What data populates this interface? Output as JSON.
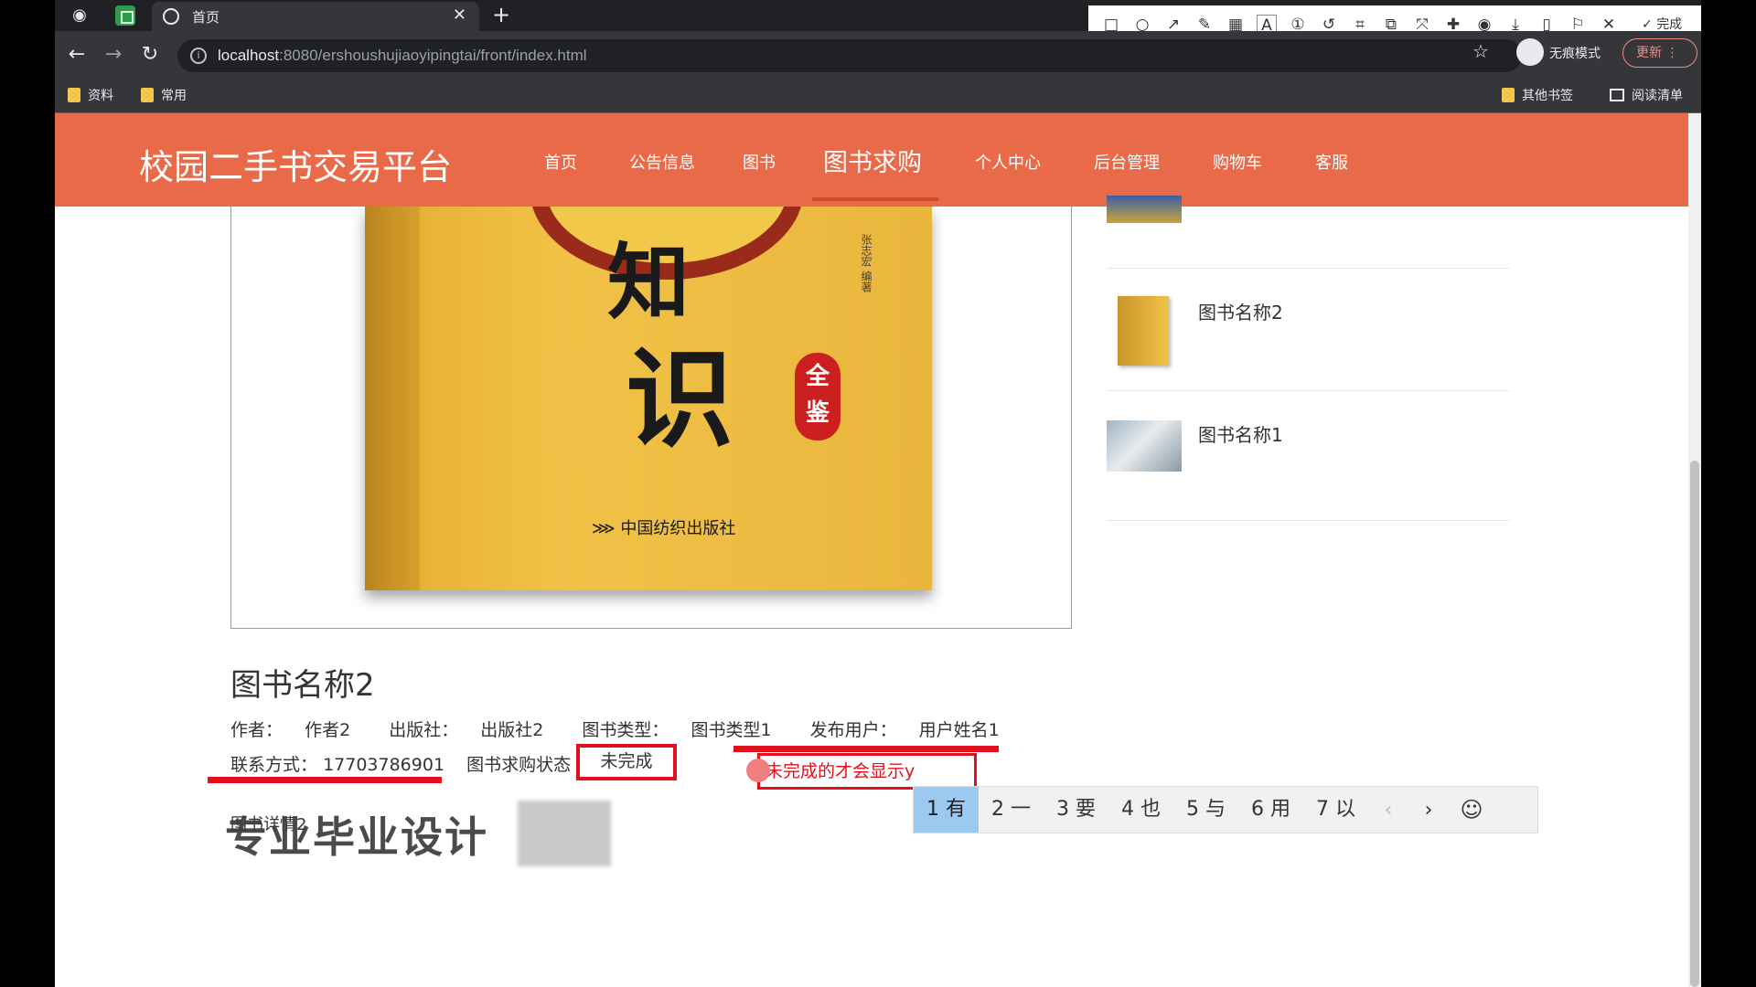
{
  "browser": {
    "tab_title": "首页",
    "tab_close": "✕",
    "new_tab": "+",
    "url_host": "localhost",
    "url_rest": ":8080/ershoushujiaoyipingtai/front/index.html",
    "incognito_label": "无痕模式",
    "update_label": "更新",
    "bookmarks": [
      "资料",
      "常用"
    ],
    "other_bookmarks": "其他书签",
    "reading_list": "阅读清单"
  },
  "annotation_toolbar": {
    "font_size": "12",
    "done_label": "完成",
    "current_color": "#f23a3a",
    "palette": [
      "#000000",
      "#808080",
      "#800000",
      "#ff8c00",
      "#2e8b57",
      "#4169e1",
      "#800080",
      "#20b2aa",
      "#ffffff",
      "#c0c0c0",
      "#ff3030",
      "#ffff00",
      "#9acd32",
      "#1e90ff",
      "#ff00ff",
      "#40e0d0"
    ]
  },
  "site": {
    "brand": "校园二手书交易平台",
    "nav": [
      "首页",
      "公告信息",
      "图书",
      "图书求购",
      "个人中心",
      "后台管理",
      "购物车",
      "客服"
    ],
    "active_nav": "图书求购",
    "accent": "#e86a48"
  },
  "cover": {
    "char1": "知",
    "char2": "识",
    "badge": "全鉴",
    "publisher": "中国纺织出版社",
    "vertical_text": "张志宏 编著"
  },
  "book": {
    "title": "图书名称2",
    "author_label": "作者：",
    "author": "作者2",
    "publisher_label": "出版社：",
    "publisher": "出版社2",
    "type_label": "图书类型：",
    "type": "图书类型1",
    "poster_label": "发布用户：",
    "poster": "用户姓名1",
    "contact_label": "联系方式：",
    "contact": "17703786901",
    "status_label": "图书求购状态",
    "status": "未完成",
    "detail_label": "图书详情2"
  },
  "annotation_note": "未完成的才会显示y",
  "watermark": "专业毕业设计",
  "ime": {
    "candidates": [
      "1 有",
      "2 一",
      "3 要",
      "4 也",
      "5 与",
      "6 用",
      "7 以"
    ],
    "prev": "‹",
    "next": "›",
    "emoji": "☺"
  },
  "sidebar": [
    {
      "title": "图书名称2"
    },
    {
      "title": "图书名称1"
    }
  ]
}
